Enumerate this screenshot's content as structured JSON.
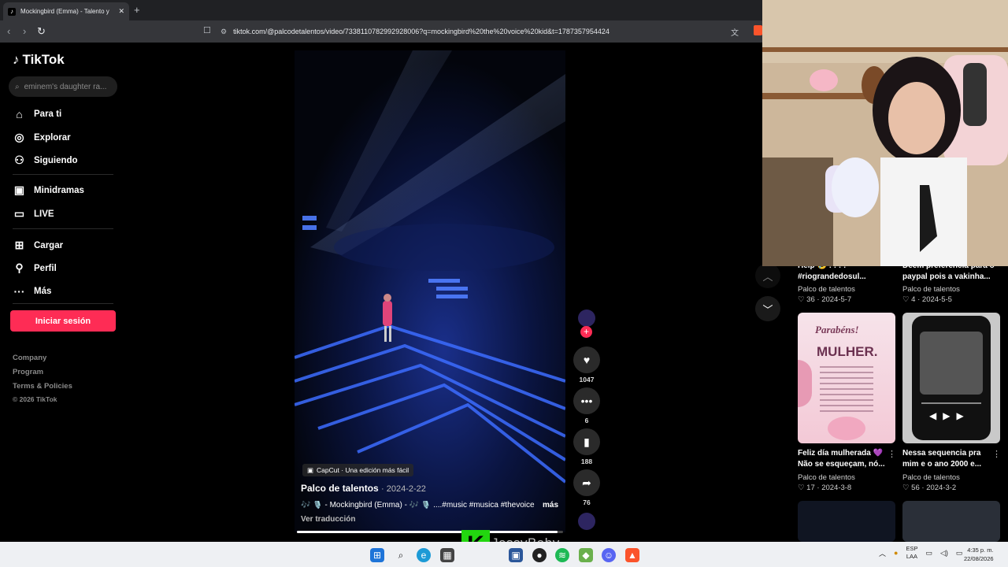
{
  "browser": {
    "tab_title": "Mockingbird (Emma) - Talento y",
    "tab_close": "✕",
    "new_tab": "+",
    "url": "tiktok.com/@palcodetalentos/video/7338110782992928006?q=mockingbird%20the%20voice%20kid&t=1787357954424"
  },
  "sidebar": {
    "brand": "TikTok",
    "search_placeholder": "eminem's daughter ra...",
    "nav": [
      {
        "label": "Para ti",
        "icon": "home-icon"
      },
      {
        "label": "Explorar",
        "icon": "compass-icon"
      },
      {
        "label": "Siguiendo",
        "icon": "following-icon"
      },
      {
        "label": "Minidramas",
        "icon": "minidrama-icon"
      },
      {
        "label": "LIVE",
        "icon": "live-icon"
      },
      {
        "label": "Cargar",
        "icon": "upload-icon"
      },
      {
        "label": "Perfil",
        "icon": "profile-icon"
      },
      {
        "label": "Más",
        "icon": "more-icon"
      }
    ],
    "login": "Iniciar sesión",
    "footer": [
      "Company",
      "Program",
      "Terms & Policies"
    ],
    "copyright": "© 2026 TikTok"
  },
  "video": {
    "capcut_badge": "CapCut · Una edición más fácil",
    "author": "Palco de talentos",
    "date": "· 2024-2-22",
    "description": "🎶 🎙️ - Mockingbird (Emma) - 🎶 🎙️ ....#music #musica #thevoice ...",
    "more": "más",
    "translate": "Ver traducción",
    "progress": 0.98,
    "likes": "1047",
    "comments": "6",
    "saves": "188",
    "shares": "76",
    "follow_plus": "+"
  },
  "related": [
    {
      "title_line1": "Help 😢 ! ! ! !",
      "title_line2": "#riograndedosul...",
      "author": "Palco de talentos",
      "likes": "36",
      "date": "2024-5-7"
    },
    {
      "title_line1": "Deem preferencia para o",
      "title_line2": "paypal pois a vakinha...",
      "author": "Palco de talentos",
      "likes": "4",
      "date": "2024-5-5"
    },
    {
      "title_line1": "Feliz día mulherada 💜",
      "title_line2": "Não se esqueçam, nó...",
      "author": "Palco de talentos",
      "likes": "17",
      "date": "2024-3-8",
      "thumb_heading": "Parabéns!",
      "thumb_title": "MULHER."
    },
    {
      "title_line1": "Nessa sequencia pra",
      "title_line2": "mim e o ano 2000 e...",
      "author": "Palco de talentos",
      "likes": "56",
      "date": "2024-3-2"
    }
  ],
  "stream": {
    "watermark": "JessyBaby",
    "brand_letter": "K"
  },
  "taskbar": {
    "lang_top": "ESP",
    "lang_bottom": "LAA",
    "time": "4:35 p. m.",
    "date": "22/08/2026"
  },
  "colors": {
    "accent": "#fe2c55",
    "kick_green": "#22d60f"
  }
}
